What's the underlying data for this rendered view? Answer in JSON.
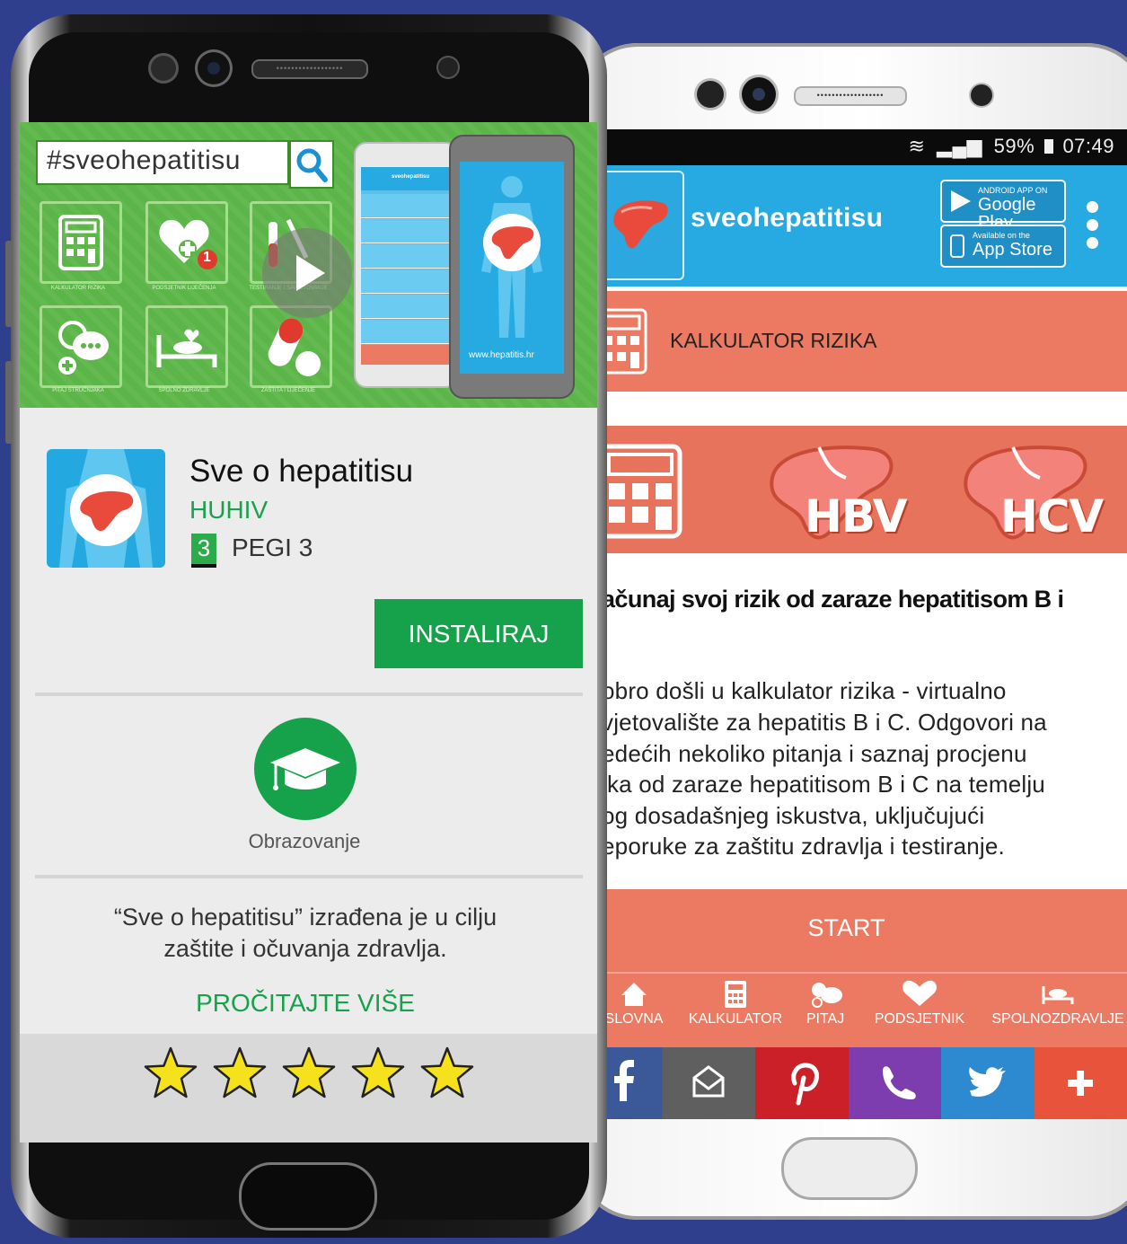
{
  "right_phone": {
    "status": {
      "battery": "59%",
      "time": "07:49"
    },
    "appbar": {
      "brand": "sveohepatitisu",
      "google_play_small": "ANDROID APP ON",
      "google_play": "Google Play",
      "app_store_small": "Available on the",
      "app_store": "App Store"
    },
    "kalkulator_label": "KALKULATOR RIZIKA",
    "banner": {
      "hbv": "HBV",
      "hcv": "HCV"
    },
    "heading": "ačunaj svoj rizik od zaraze hepatitisom B i",
    "body_lines": [
      "obro došli u kalkulator rizika - virtualno",
      "vjetovalište za hepatitis B i C. Odgovori na",
      "edećih nekoliko pitanja i saznaj procjenu",
      "ika od zaraze hepatitisom B i C na temelju",
      "og dosadašnjeg iskustva, uključujući",
      "eporuke za zaštitu zdravlja i testiranje."
    ],
    "start_label": "START",
    "nav": [
      "SLOVNA",
      "KALKULATOR",
      "PITAJ",
      "PODSJETNIK",
      "SPOLNOZDRAVLJE"
    ],
    "social_icons": [
      "facebook-icon",
      "email-icon",
      "pinterest-icon",
      "viber-icon",
      "twitter-icon",
      "plus-icon"
    ],
    "colors": {
      "accent_blue": "#27a9e1",
      "salmon": "#ec7961",
      "green": "#16a24a"
    }
  },
  "left_phone": {
    "hero": {
      "search_text": "#sveohepatitisu",
      "tile_captions": [
        "KALKULATOR RIZIKA",
        "PODSJETNIK LIJEČENJA",
        "TESTIRANJE I SAVJETOVANJE",
        "PITAJ STRUČNJAKA",
        "SPOLNO ZDRAVLJE",
        "ZAŠTITA I LIJEČENJE"
      ],
      "notification_count": "1",
      "mini_brand": "sveohepatitisu",
      "url": "www.hepatitis.hr"
    },
    "app": {
      "title": "Sve o hepatitisu",
      "developer": "HUHIV",
      "pegi_number": "3",
      "pegi_label": "PEGI 3",
      "install_label": "INSTALIRAJ",
      "category": "Obrazovanje",
      "description_line1": "“Sve o hepatitisu” izrađena je u cilju",
      "description_line2": "zaštite i očuvanja zdravlja.",
      "read_more": "PROČITAJTE VIŠE",
      "rating_stars": 5
    }
  }
}
